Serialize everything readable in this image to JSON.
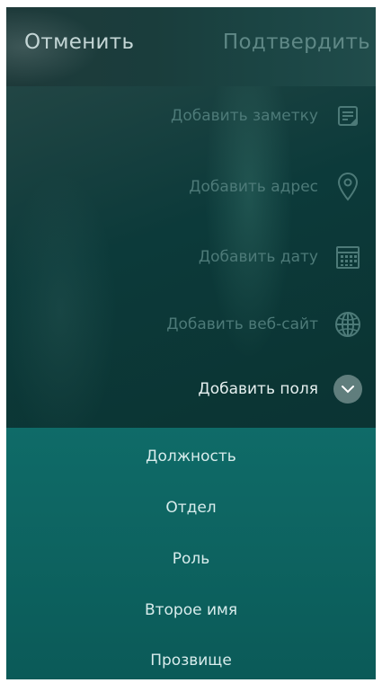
{
  "header": {
    "cancel_label": "Отменить",
    "confirm_label": "Подтвердить"
  },
  "actions": [
    {
      "label": "Добавить заметку",
      "icon": "note-icon"
    },
    {
      "label": "Добавить адрес",
      "icon": "location-pin-icon"
    },
    {
      "label": "Добавить дату",
      "icon": "calendar-icon"
    },
    {
      "label": "Добавить веб-сайт",
      "icon": "globe-icon"
    }
  ],
  "add_fields": {
    "label": "Добавить поля",
    "icon": "chevron-down-icon"
  },
  "menu": {
    "items": [
      "Должность",
      "Отдел",
      "Роль",
      "Второе имя",
      "Прозвище"
    ]
  },
  "colors": {
    "accent": "#0f6b68",
    "background": "#0b3534",
    "dim_text": "#4d7a78",
    "bright_text": "#e6f0f0"
  }
}
